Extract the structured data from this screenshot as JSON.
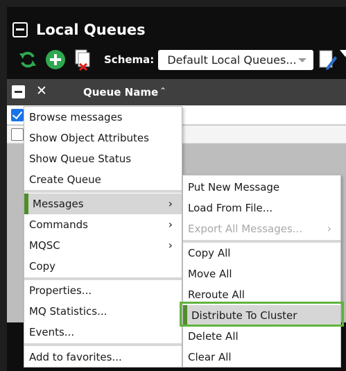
{
  "window": {
    "title": "Local Queues"
  },
  "toolbar": {
    "refresh_icon": "refresh-icon",
    "add_icon": "add-icon",
    "delete_icon": "delete-document-icon",
    "schema_label": "Schema:",
    "schema_value": "Default Local Queues...",
    "edit_icon": "edit-schema-icon"
  },
  "grid": {
    "header": {
      "column": "Queue Name",
      "sort": "⌃"
    },
    "rows": [
      {
        "checked": true
      },
      {
        "checked": false
      }
    ]
  },
  "context_menu": {
    "items": [
      {
        "label": "Browse messages"
      },
      {
        "label": "Show Object Attributes"
      },
      {
        "label": "Show Queue Status"
      },
      {
        "label": "Create Queue"
      },
      {
        "label": "Messages",
        "submenu": true,
        "highlighted": true
      },
      {
        "label": "Commands",
        "submenu": true
      },
      {
        "label": "MQSC",
        "submenu": true
      },
      {
        "label": "Copy"
      },
      {
        "label": "Properties..."
      },
      {
        "label": "MQ Statistics..."
      },
      {
        "label": "Events..."
      },
      {
        "label": "Add to favorites..."
      }
    ]
  },
  "messages_submenu": {
    "items": [
      {
        "label": "Put New Message"
      },
      {
        "label": "Load From File..."
      },
      {
        "label": "Export All Messages...",
        "disabled": true,
        "submenu": true
      },
      {
        "label": "Copy All"
      },
      {
        "label": "Move All"
      },
      {
        "label": "Reroute All"
      },
      {
        "label": "Distribute To Cluster",
        "highlighted": true
      },
      {
        "label": "Delete All"
      },
      {
        "label": "Clear All"
      }
    ]
  },
  "colors": {
    "accent_green": "#5fb43d",
    "highlight_bar": "#4e8f2a",
    "header_bg": "#3f3f3f"
  }
}
